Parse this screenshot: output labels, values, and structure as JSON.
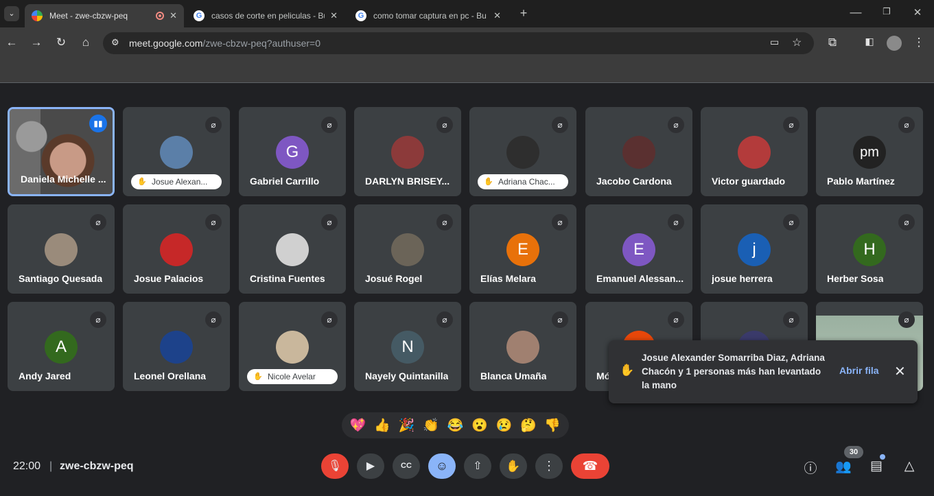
{
  "browser": {
    "tabs": [
      {
        "title": "Meet - zwe-cbzw-peq",
        "active": true
      },
      {
        "title": "casos de corte en peliculas - Bú",
        "active": false
      },
      {
        "title": "como tomar captura en pc - Bu",
        "active": false
      }
    ],
    "url_host": "meet.google.com",
    "url_path": "/zwe-cbzw-peq?authuser=0",
    "new_tab": "+",
    "close_glyph": "✕"
  },
  "participants": [
    {
      "name": "Daniela Michelle ...",
      "type": "video",
      "speaking": true
    },
    {
      "name": "Josue Alexan...",
      "type": "photo",
      "hand": true,
      "color": "#5b7fa8"
    },
    {
      "name": "Gabriel Carrillo",
      "type": "initial",
      "initial": "G",
      "color": "#7e57c2"
    },
    {
      "name": "DARLYN BRISEY...",
      "type": "photo",
      "color": "#8c3a3a"
    },
    {
      "name": "Adriana Chac...",
      "type": "photo",
      "hand": true,
      "color": "#2e2e2e"
    },
    {
      "name": "Jacobo Cardona",
      "type": "photo",
      "color": "#5a3030"
    },
    {
      "name": "Victor guardado",
      "type": "photo",
      "color": "#b33b3b"
    },
    {
      "name": "Pablo Martínez",
      "type": "initial",
      "initial": "pm",
      "color": "#222222"
    },
    {
      "name": "Santiago Quesada",
      "type": "photo",
      "color": "#9a8b7b"
    },
    {
      "name": "Josue Palacios",
      "type": "photo",
      "color": "#c62828"
    },
    {
      "name": "Cristina Fuentes",
      "type": "photo",
      "color": "#d0d0d0"
    },
    {
      "name": "Josué Rogel",
      "type": "photo",
      "color": "#6b6458"
    },
    {
      "name": "Elías Melara",
      "type": "initial",
      "initial": "E",
      "color": "#e8710a"
    },
    {
      "name": "Emanuel Alessan...",
      "type": "initial",
      "initial": "E",
      "color": "#7e57c2"
    },
    {
      "name": "josue herrera",
      "type": "initial",
      "initial": "j",
      "color": "#1a5fb4"
    },
    {
      "name": "Herber Sosa",
      "type": "initial",
      "initial": "H",
      "color": "#33691e"
    },
    {
      "name": "Andy Jared",
      "type": "initial",
      "initial": "A",
      "color": "#33691e"
    },
    {
      "name": "Leonel Orellana",
      "type": "photo",
      "color": "#1d428a"
    },
    {
      "name": "Nicole Avelar",
      "type": "photo",
      "hand": true,
      "color": "#c9b79c"
    },
    {
      "name": "Nayely Quintanilla",
      "type": "initial",
      "initial": "N",
      "color": "#455a64"
    },
    {
      "name": "Blanca Umaña",
      "type": "photo",
      "color": "#a08070"
    },
    {
      "name": "Mó",
      "type": "initial",
      "initial": "",
      "color": "#e8470a"
    },
    {
      "name": "",
      "type": "photo",
      "color": "#3a3a6a"
    },
    {
      "name": "",
      "type": "video",
      "color": "#9ab0a0"
    }
  ],
  "toast": {
    "message": "Josue Alexander Somarriba Diaz, Adriana Chacón y 1 personas más han levantado la mano",
    "action": "Abrir fila",
    "hand_icon": "✋",
    "close": "✕"
  },
  "reactions": [
    "💖",
    "👍",
    "🎉",
    "👏",
    "😂",
    "😮",
    "😢",
    "🤔",
    "👎"
  ],
  "bottom": {
    "time": "22:00",
    "separator": "|",
    "meeting_code": "zwe-cbzw-peq",
    "participant_count": "30"
  },
  "colors": {
    "background": "#202124",
    "tile": "#3c4043",
    "accent": "#8ab4f8",
    "danger": "#ea4335"
  }
}
